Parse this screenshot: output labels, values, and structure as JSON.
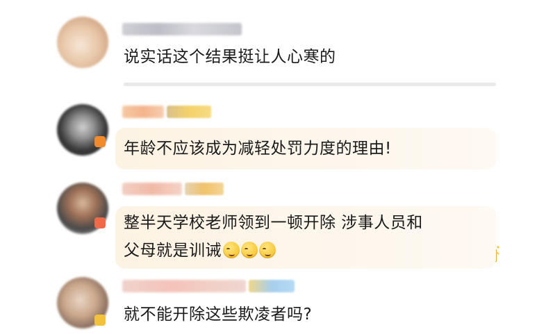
{
  "comments": [
    {
      "text": "说实话这个结果挺让人心寒的"
    },
    {
      "text": "年龄不应该成为减轻处罚力度的理由!"
    },
    {
      "line1": "整半天学校老师领到一顿开除 涉事人员和",
      "line2": "父母就是训诫"
    },
    {
      "text": "就不能开除这些欺凌者吗?"
    }
  ],
  "colors": {
    "text": "#1a1a1a",
    "highlight_bubble": "#fdf6e8",
    "divider": "#e9e9e9",
    "badge_orange": "#f5a23a"
  },
  "icons": [
    "avatar",
    "vip-badge-icon",
    "crown-badge-icon",
    "smirk-emoji-icon"
  ]
}
